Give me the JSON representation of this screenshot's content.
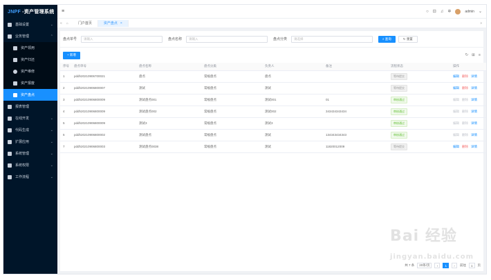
{
  "app": {
    "logo_brand": "JNPF",
    "logo_text": "-资产管理系统"
  },
  "sidebar": {
    "items": [
      {
        "label": "基础设置",
        "level": 0,
        "active": false,
        "chevron": "⌄",
        "icon": "settings-icon"
      },
      {
        "label": "业务管理",
        "level": 0,
        "active": false,
        "chevron": "⌃",
        "icon": "folder-icon"
      },
      {
        "label": "资产领用",
        "level": 1,
        "active": false,
        "icon": "receive-icon"
      },
      {
        "label": "资产归还",
        "level": 1,
        "active": false,
        "icon": "return-icon"
      },
      {
        "label": "资产维修",
        "level": 1,
        "active": false,
        "icon": "repair-icon"
      },
      {
        "label": "资产报废",
        "level": 1,
        "active": false,
        "icon": "scrap-icon"
      },
      {
        "label": "资产盘点",
        "level": 1,
        "active": true,
        "icon": "inventory-icon"
      },
      {
        "label": "报表管理",
        "level": 0,
        "active": false,
        "chevron": "",
        "icon": "chart-icon"
      },
      {
        "label": "在线开发",
        "level": 0,
        "active": false,
        "chevron": "⌄",
        "icon": "code-icon"
      },
      {
        "label": "代码生成",
        "level": 0,
        "active": false,
        "chevron": "⌄",
        "icon": "generate-icon"
      },
      {
        "label": "扩展应用",
        "level": 0,
        "active": false,
        "chevron": "⌄",
        "icon": "apps-icon"
      },
      {
        "label": "系统管理",
        "level": 0,
        "active": false,
        "chevron": "⌄",
        "icon": "system-icon"
      },
      {
        "label": "系统权限",
        "level": 0,
        "active": false,
        "chevron": "⌄",
        "icon": "permission-icon"
      },
      {
        "label": "工作流程",
        "level": 0,
        "active": false,
        "chevron": "⌄",
        "icon": "workflow-icon"
      }
    ]
  },
  "topbar": {
    "user_name": "admin"
  },
  "tabs": [
    {
      "label": "门户首页",
      "active": false
    },
    {
      "label": "资产盘点",
      "active": true
    }
  ],
  "search": {
    "fields": [
      {
        "label": "盘点单号",
        "placeholder": "请输入"
      },
      {
        "label": "盘点名称",
        "placeholder": "请输入"
      },
      {
        "label": "盘点分类",
        "placeholder": "请选择"
      }
    ],
    "query_label": "查询",
    "reset_label": "重置"
  },
  "toolbar": {
    "add_label": "+ 新增"
  },
  "table": {
    "columns": [
      "序号",
      "盘点单号",
      "盘点名称",
      "盘点分类",
      "负责人",
      "备注",
      "流程状态",
      "操作"
    ],
    "rows": [
      {
        "cells": [
          "1",
          "pddh20210906700021",
          "盘点",
          "常规盘点",
          "盘点",
          "",
          ""
        ],
        "status": "等待提交",
        "status_type": "grey",
        "enabled": true
      },
      {
        "cells": [
          "2",
          "pddh20210906800007",
          "测试",
          "常规盘点",
          "测试",
          "",
          ""
        ],
        "status": "等待提交",
        "status_type": "grey",
        "enabled": true
      },
      {
        "cells": [
          "3",
          "pddh20210906800009",
          "测试盘点001",
          "常规盘点",
          "测试001",
          "01",
          ""
        ],
        "status": "审核通过",
        "status_type": "green",
        "enabled": false
      },
      {
        "cells": [
          "4",
          "pddh20210906800009",
          "测试盘点002",
          "常规盘点",
          "测试002",
          "343434343434",
          ""
        ],
        "status": "审核通过",
        "status_type": "green",
        "enabled": false
      },
      {
        "cells": [
          "5",
          "pddh20210906800009",
          "测试3",
          "常规盘点",
          "测试3",
          "",
          ""
        ],
        "status": "审核通过",
        "status_type": "green",
        "enabled": false
      },
      {
        "cells": [
          "6",
          "pddh20210906800002",
          "测试盘点",
          "常规盘点",
          "测试",
          "134343434343",
          ""
        ],
        "status": "审核通过",
        "status_type": "green",
        "enabled": false
      },
      {
        "cells": [
          "7",
          "pddh20210906800003",
          "测试盘点0038",
          "常规盘点",
          "测试",
          "11820012009",
          ""
        ],
        "status": "等待提交",
        "status_type": "grey",
        "enabled": true
      }
    ],
    "actions": [
      "编辑",
      "删除",
      "详情"
    ]
  },
  "pager": {
    "total_text": "共 7 条",
    "page_size": "20条/页",
    "current": "1",
    "goto_label": "前往",
    "goto_value": "1",
    "page_unit": "页"
  },
  "watermark": {
    "brand": "Bai 经验",
    "sub": "jingyan.baidu.com"
  }
}
